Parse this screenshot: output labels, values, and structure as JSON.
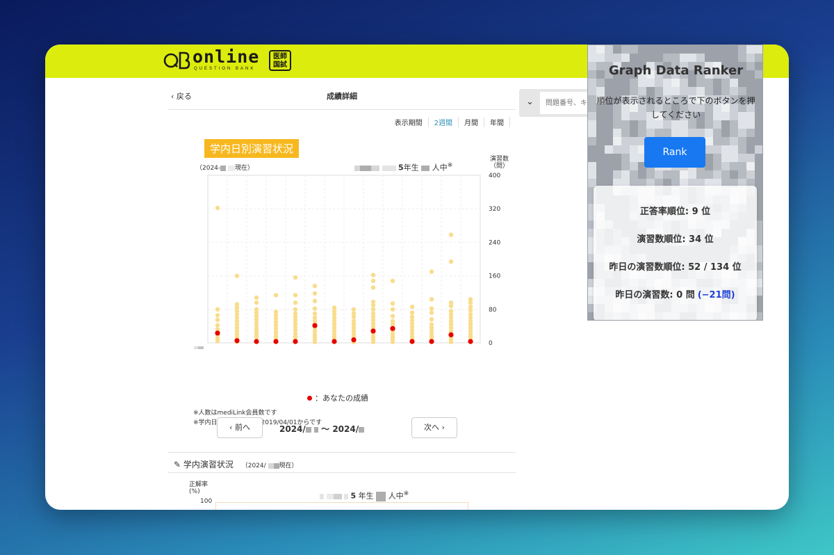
{
  "app": {
    "logo_text": "online",
    "logo_sub": "QUESTION BANK",
    "logo_badge_line1": "医師",
    "logo_badge_line2": "国試"
  },
  "nav": {
    "back_label": "戻る",
    "page_title": "成績詳細"
  },
  "period": {
    "label": "表示期間",
    "options": [
      "2週間",
      "月間",
      "年間"
    ],
    "selected": "2週間"
  },
  "chart_header": {
    "title": "学内日別演習状況",
    "subtitle_prefix": "（2024-",
    "subtitle_suffix": "現在）",
    "grade": "5",
    "grade_suffix": "年生",
    "people_suffix": "人中",
    "note_mark": "※",
    "ylabel_line1": "演習数",
    "ylabel_line2": "（問）"
  },
  "chart_data": {
    "type": "scatter",
    "ylabel": "演習数（問）",
    "ylim": [
      0,
      400
    ],
    "yticks": [
      0,
      80,
      160,
      240,
      320,
      400
    ],
    "x_first_label": "2024",
    "categories": 14,
    "series": [
      {
        "name": "",
        "color": "#f9dc8c",
        "values": [
          [
            4,
            10,
            18,
            26,
            32,
            42,
            55,
            66,
            80,
            322
          ],
          [
            2,
            8,
            14,
            20,
            28,
            36,
            44,
            52,
            60,
            68,
            76,
            84,
            92,
            160
          ],
          [
            2,
            6,
            12,
            18,
            24,
            32,
            40,
            48,
            56,
            64,
            72,
            80,
            96,
            108
          ],
          [
            2,
            8,
            14,
            20,
            26,
            34,
            42,
            50,
            58,
            66,
            74,
            114
          ],
          [
            2,
            8,
            14,
            22,
            30,
            38,
            46,
            54,
            62,
            70,
            80,
            96,
            114,
            156
          ],
          [
            2,
            8,
            14,
            20,
            28,
            36,
            44,
            52,
            60,
            70,
            82,
            100,
            118,
            136
          ],
          [
            2,
            8,
            14,
            20,
            28,
            36,
            44,
            52,
            60,
            68,
            76,
            84
          ],
          [
            2,
            8,
            14,
            20,
            28,
            36,
            44,
            52,
            62,
            70,
            80
          ],
          [
            2,
            8,
            14,
            22,
            30,
            38,
            46,
            54,
            62,
            70,
            80,
            90,
            98,
            132,
            148,
            162
          ],
          [
            2,
            8,
            14,
            20,
            28,
            36,
            44,
            52,
            64,
            80,
            94,
            148
          ],
          [
            2,
            8,
            14,
            22,
            30,
            38,
            46,
            54,
            62,
            72,
            86
          ],
          [
            2,
            8,
            14,
            20,
            28,
            36,
            44,
            56,
            72,
            82,
            104,
            170
          ],
          [
            2,
            8,
            14,
            20,
            28,
            36,
            44,
            52,
            60,
            68,
            76,
            88,
            96,
            194,
            258
          ],
          [
            2,
            8,
            14,
            20,
            28,
            36,
            44,
            52,
            60,
            68,
            78,
            86,
            96,
            104
          ]
        ]
      },
      {
        "name": "あなたの成績",
        "color": "#e60000",
        "values": [
          20,
          2,
          0,
          0,
          0,
          38,
          0,
          4,
          25,
          31,
          0,
          0,
          16,
          0
        ]
      }
    ]
  },
  "notes": [
    "※人数はmediLink会員数です",
    "※学内日別演習の集計は2019/04/01からです"
  ],
  "legend_label": "：あなたの成績",
  "pager": {
    "prev_label": "前へ",
    "next_label": "次へ",
    "range_prefix": "2024/",
    "range_mid": "〜 2024/"
  },
  "section2": {
    "title": "学内演習状況",
    "subtitle_prefix": "（2024/",
    "subtitle_suffix": "現在）",
    "ylabel_line1": "正解率",
    "ylabel_line2": "(%)",
    "y_top": "100",
    "grade": "5",
    "grade_suffix": "年生",
    "people_suffix": "人中",
    "note_mark": "※"
  },
  "search": {
    "placeholder": "問題番号、キ"
  },
  "ranker": {
    "title": "Graph Data Ranker",
    "description": "順位が表示されるところで下のボタンを押してください",
    "button_label": "Rank",
    "results": {
      "accuracy_rank": "正答率順位: 9 位",
      "exercise_rank": "演習数順位: 34 位",
      "yesterday_rank": "昨日の演習数順位: 52 / 134 位",
      "yesterday_count": "昨日の演習数: 0 問",
      "yesterday_delta": "(−21問)"
    },
    "accent": "#1778f2",
    "delta_color": "#1f3fd8"
  },
  "colors": {
    "brand_yellow": "#dcec0c",
    "title_badge": "#f7b81f",
    "link_blue": "#2b8fb5"
  }
}
